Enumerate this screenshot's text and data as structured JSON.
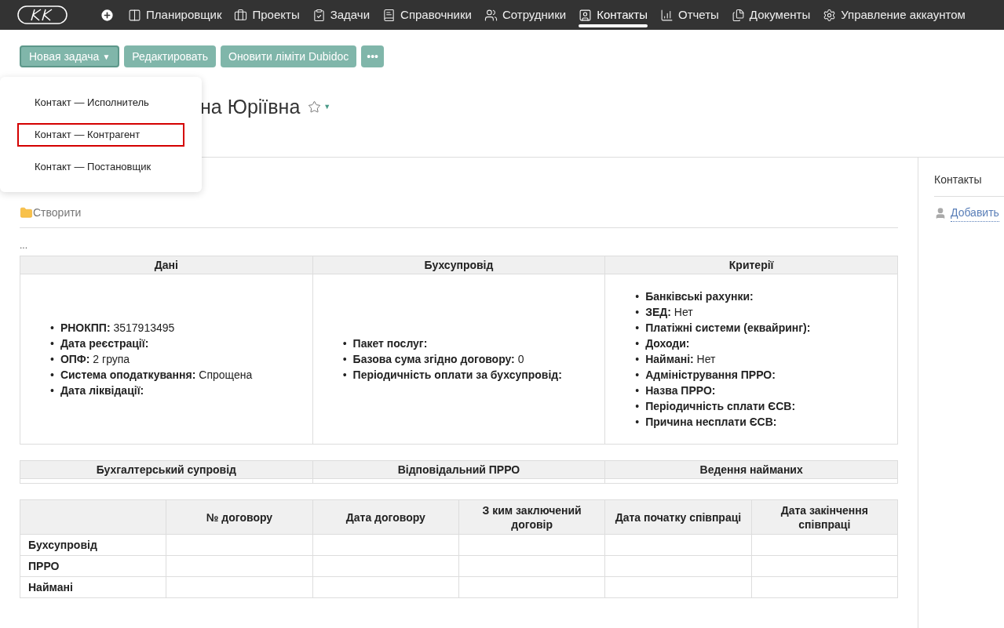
{
  "nav": {
    "items": [
      {
        "label": "Планировщик",
        "selected": false
      },
      {
        "label": "Проекты",
        "selected": false
      },
      {
        "label": "Задачи",
        "selected": false
      },
      {
        "label": "Справочники",
        "selected": false
      },
      {
        "label": "Сотрудники",
        "selected": false
      },
      {
        "label": "Контакты",
        "selected": true
      },
      {
        "label": "Отчеты",
        "selected": false
      },
      {
        "label": "Документы",
        "selected": false
      },
      {
        "label": "Управление аккаунтом",
        "selected": false
      }
    ]
  },
  "toolbar": {
    "buttons": [
      {
        "label": "Новая задача",
        "kind": "dropdown",
        "caret": "▼"
      },
      {
        "label": "Редактировать",
        "kind": "plain"
      },
      {
        "label": "Оновити ліміти Dubidoc",
        "kind": "plain"
      },
      {
        "label": "•••",
        "kind": "more"
      }
    ]
  },
  "menu": {
    "items": [
      {
        "label": "Контакт — Исполнитель",
        "highlighted": false
      },
      {
        "label": "Контакт — Контрагент",
        "highlighted": true
      },
      {
        "label": "Контакт — Постановщик",
        "highlighted": false
      }
    ]
  },
  "title": {
    "text": "на Юріївна",
    "starred": false,
    "caret": "▼"
  },
  "create_link": "Створити",
  "ellipsis": "...",
  "info_table": {
    "bullet": "•",
    "columns": [
      "Дані",
      "Бухсупровід",
      "Критерії"
    ],
    "cells": [
      [
        {
          "label": "РНОКПП:",
          "value": "3517913495"
        },
        {
          "label": "Дата реєстрації:"
        },
        {
          "label": "ОПФ:",
          "value": "2 група"
        },
        {
          "label": "Система оподаткування:",
          "value": "Спрощена"
        },
        {
          "label": "Дата ліквідації:"
        }
      ],
      [
        {
          "label": "Пакет послуг:"
        },
        {
          "label": "Базова сума згідно договору:",
          "value": "0"
        },
        {
          "label": "Періодичність оплати за бухсупровід:"
        }
      ],
      [
        {
          "label": "Банківські рахунки:"
        },
        {
          "label": "ЗЕД:",
          "value": "Нет"
        },
        {
          "label": "Платіжні системи (еквайринг):"
        },
        {
          "label": "Доходи:"
        },
        {
          "label": "Наймані:",
          "value": "Нет"
        },
        {
          "label": "Адміністрування ПРРО:"
        },
        {
          "label": "Назва ПРРО:"
        },
        {
          "label": "Періодичність сплати ЄСВ:"
        },
        {
          "label": "Причина несплати ЄСВ:"
        }
      ]
    ]
  },
  "service_table": {
    "columns": [
      "Бухгалтерський супровід",
      "Відповідальний ПРРО",
      "Ведення найманих"
    ]
  },
  "contracts_table": {
    "columns": [
      "№ договору",
      "Дата договору",
      "З ким заключений договір",
      "Дата початку співпраці",
      "Дата закінчення співпраці"
    ],
    "rows": [
      "Бухсупровід",
      "ПРРО",
      "Наймані"
    ]
  },
  "sidebar": {
    "title": "Контакты",
    "link": "Добавить"
  }
}
